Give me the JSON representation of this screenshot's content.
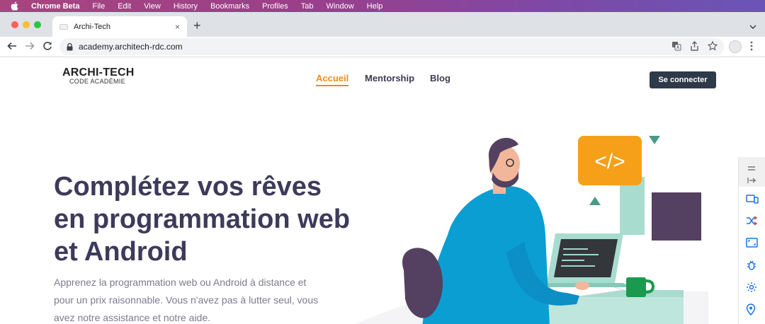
{
  "menubar": {
    "app_name": "Chrome Beta",
    "items": [
      "File",
      "Edit",
      "View",
      "History",
      "Bookmarks",
      "Profiles",
      "Tab",
      "Window",
      "Help"
    ]
  },
  "browser": {
    "tab_title": "Archi-Tech",
    "tab_close": "×",
    "new_tab": "+",
    "url": "academy.architech-rdc.com"
  },
  "site": {
    "logo_main": "ARCHI-TECH",
    "logo_sub": "CODE ACADÉMIE",
    "nav": {
      "home": "Accueil",
      "mentorship": "Mentorship",
      "blog": "Blog"
    },
    "login_button": "Se connecter",
    "hero_title": "Complétez vos rêves en programmation web et Android",
    "hero_subtitle": "Apprenez la programmation web ou Android à distance et pour un prix raisonnable. Vous n'avez pas à lutter seul, vous avez notre assistance et notre aide.",
    "code_badge": "</>"
  },
  "colors": {
    "accent": "#f28c1a",
    "title": "#3d3a5a",
    "button_bg": "#2e3a4a",
    "illustration_blue": "#0b9ed3",
    "illustration_mint": "#a8dccf",
    "illustration_purple": "#544060"
  }
}
